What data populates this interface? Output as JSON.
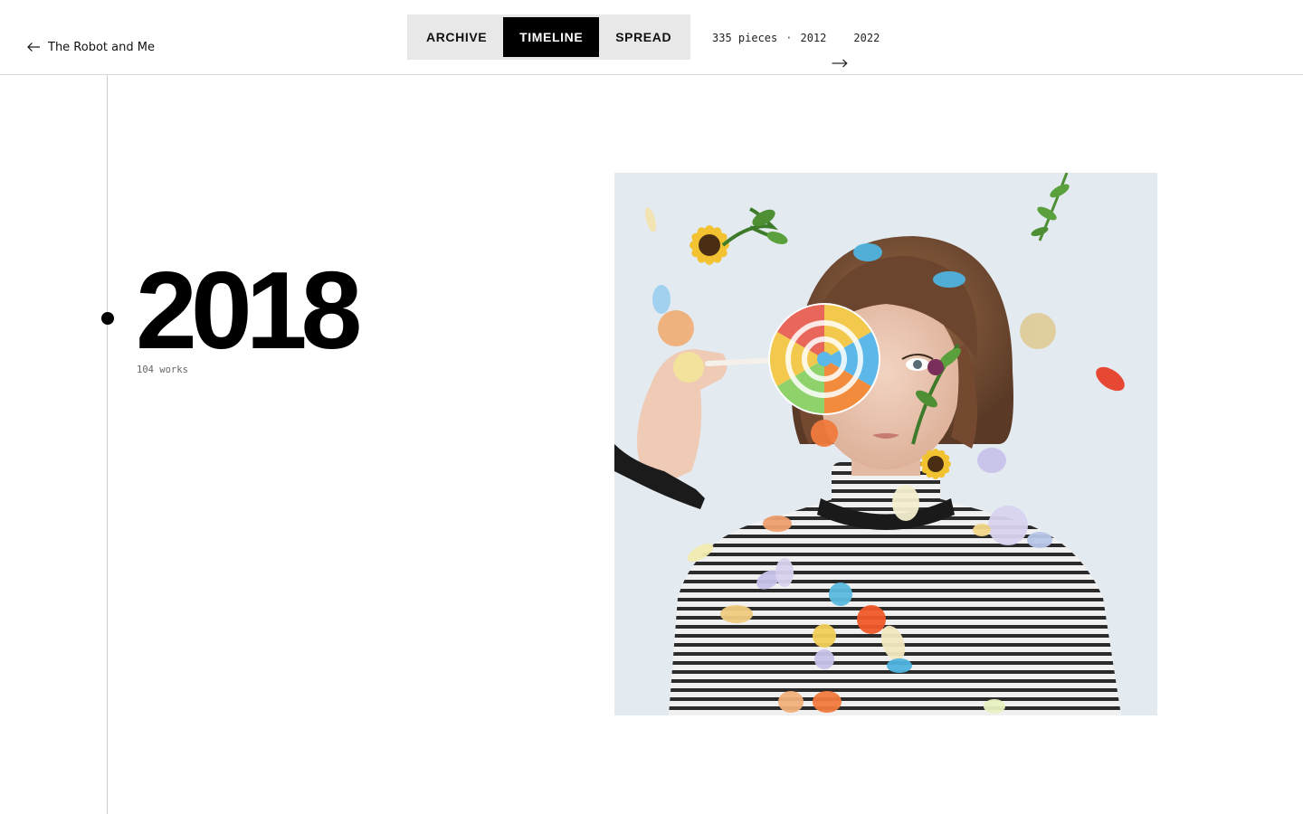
{
  "header": {
    "back_link": {
      "label": "The Robot and Me",
      "icon": "arrow-left-icon"
    },
    "view_switch": {
      "items": [
        {
          "label": "ARCHIVE",
          "active": false
        },
        {
          "label": "TIMELINE",
          "active": true
        },
        {
          "label": "SPREAD",
          "active": false
        }
      ]
    },
    "meta": {
      "count": "335 pieces",
      "separator": "·",
      "start_year": "2012",
      "arrow_icon": "long-arrow-right-icon",
      "end_year": "2022"
    }
  },
  "timeline": {
    "year": "2018",
    "works": "104 works",
    "artwork": {
      "alt": "",
      "description_visual": "collage portrait: woman in striped turtleneck holding a rainbow lollipop over one eye, surrounded by sunflowers, leaves and floating colorful confetti petals"
    }
  },
  "colors": {
    "accent": "#000000",
    "switch_bg": "#e8e8e8",
    "rail": "#cfcfcf",
    "art_bg": "#e4ebf1"
  }
}
